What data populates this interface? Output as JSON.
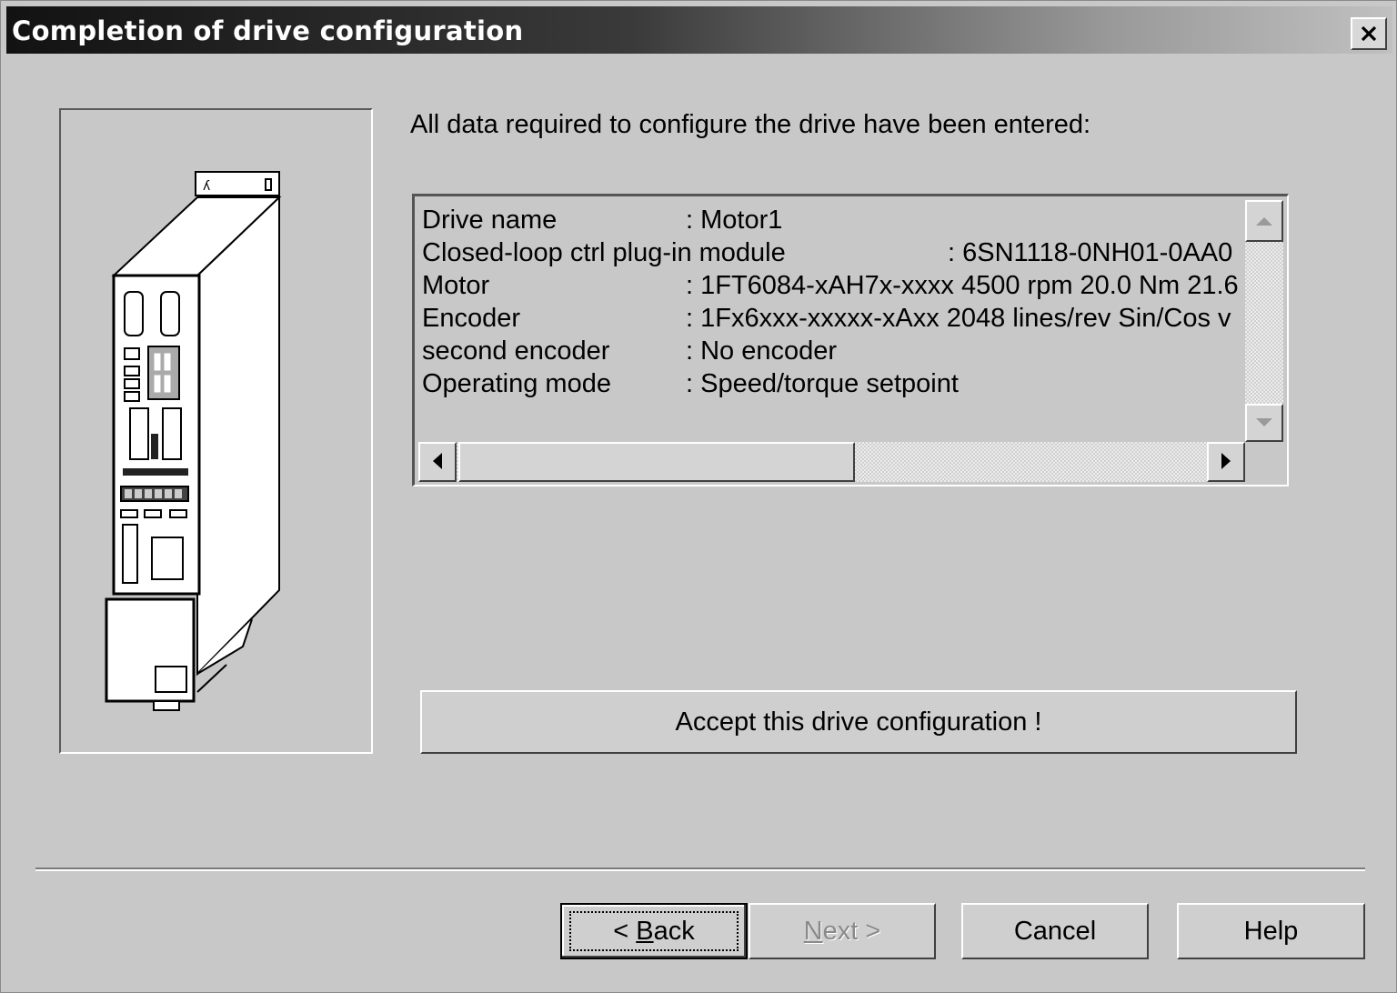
{
  "window": {
    "title": "Completion of drive configuration",
    "close_icon": "close-icon"
  },
  "main": {
    "intro": "All data required to configure the drive have been entered:",
    "summary": {
      "rows": [
        {
          "label": "Drive name",
          "value": ": Motor1"
        },
        {
          "label": "Closed-loop ctrl plug-in module",
          "value": ": 6SN1118-0NH01-0AA0"
        },
        {
          "label": "Motor",
          "value": ": 1FT6084-xAH7x-xxxx  4500 rpm  20.0 Nm 21.6"
        },
        {
          "label": "Encoder",
          "value": ": 1Fx6xxx-xxxxx-xAxx 2048 lines/rev   Sin/Cos v"
        },
        {
          "label": "second encoder",
          "value": ": No encoder"
        },
        {
          "label": "Operating mode",
          "value": ": Speed/torque setpoint"
        }
      ],
      "vertical_scroll_position": 0,
      "horizontal_scroll_position": 0
    },
    "accept_label": "Accept this drive configuration !"
  },
  "footer": {
    "back_prefix": "< ",
    "back_key": "B",
    "back_rest": "ack",
    "next_key": "N",
    "next_rest": "ext >",
    "cancel_label": "Cancel",
    "help_label": "Help"
  }
}
